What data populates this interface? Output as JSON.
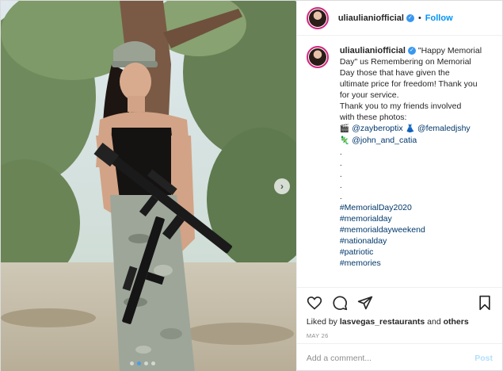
{
  "post": {
    "username": "uliaulianiofficial",
    "follow_label": "Follow",
    "separator": "•",
    "caption_lines": [
      "\"Happy Memorial",
      "Day\" us Remembering on Memorial",
      "Day those that have given the",
      "ultimate price for freedom! Thank you",
      "for your service.",
      "Thank you to my friends involved",
      "with these photos:"
    ],
    "mentions": [
      {
        "emoji": "🎬",
        "handle": "@zayberoptix"
      },
      {
        "emoji": "👗",
        "handle": "@femaledjshy"
      },
      {
        "emoji": "🦎",
        "handle": "@john_and_catia"
      }
    ],
    "dots": [
      ".",
      ".",
      ".",
      ".",
      "."
    ],
    "hashtags": [
      "#MemorialDay2020",
      "#memorialday",
      "#memorialdayweekend",
      "#nationalday",
      "#patriotic",
      "#memories"
    ],
    "likes_prefix": "Liked by ",
    "likes_user": "lasvegas_restaurants",
    "likes_suffix": " and ",
    "likes_others": "others",
    "date": "MAY 26",
    "comment_placeholder": "Add a comment...",
    "post_label": "Post"
  },
  "carousel": {
    "next_glyph": "›",
    "slide_count": 4,
    "active_index": 1
  },
  "colors": {
    "accent": "#0095f6",
    "verified": "#3897f0",
    "link": "#00376b",
    "muted": "#8e8e8e"
  },
  "icons": {
    "like": "heart-icon",
    "comment": "comment-icon",
    "share": "paper-plane-icon",
    "save": "bookmark-icon",
    "verified": "verified-badge-icon"
  }
}
